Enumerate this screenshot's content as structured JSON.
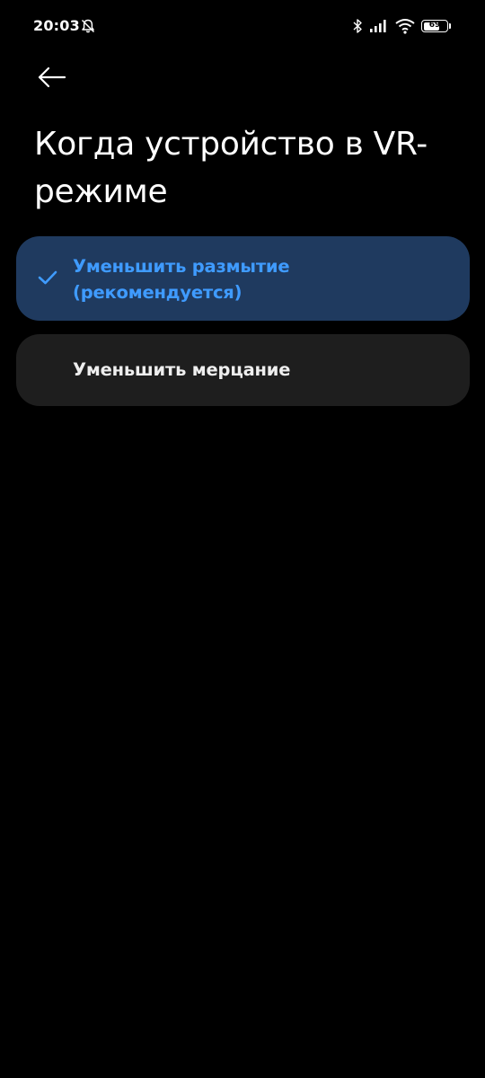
{
  "status_bar": {
    "time": "20:03",
    "battery_level": "69",
    "battery_fraction": 0.69,
    "icons": [
      "bell-off-icon",
      "bluetooth-icon",
      "signal-icon",
      "wifi-icon",
      "battery-icon"
    ]
  },
  "header": {
    "back_icon": "back-arrow-icon",
    "title": "Когда устройство в VR-режиме"
  },
  "options": [
    {
      "label": "Уменьшить размытие (рекомендуется)",
      "selected": true
    },
    {
      "label": "Уменьшить мерцание",
      "selected": false
    }
  ],
  "colors": {
    "background": "#000000",
    "accent": "#3f9bff",
    "selected_card": "#1f3a5f",
    "card": "#1e1e1e",
    "text": "#ffffff"
  }
}
